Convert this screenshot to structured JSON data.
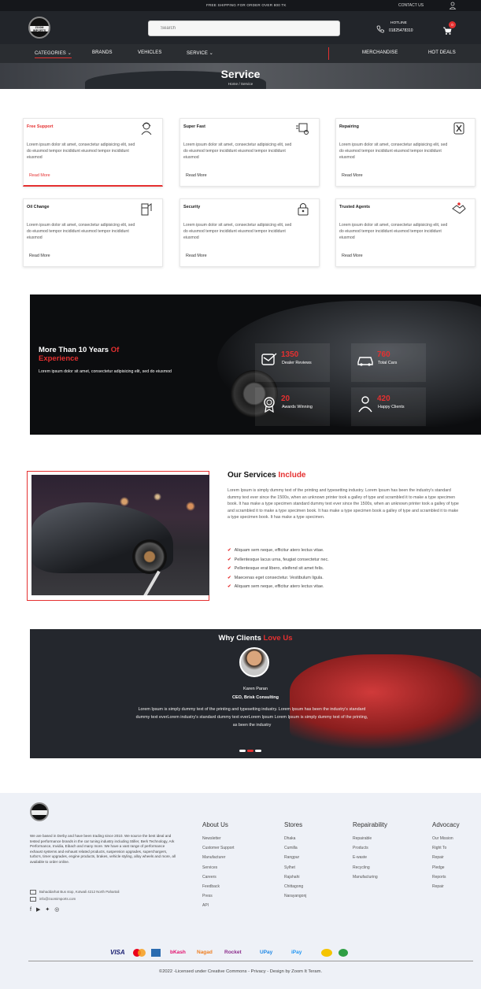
{
  "topbar": {
    "shipping": "FREE SHIPPING FOR ORDER OVER 800 TK",
    "contact": "CONTACT US"
  },
  "header": {
    "logo_text": "ZOOM IMPORTS",
    "search_placeholder": "Search",
    "hotline_label": "HOTLINE",
    "hotline_number": "01825478310",
    "cart_count": "0"
  },
  "nav": {
    "items": [
      "CATEGORIES",
      "BRANDS",
      "VEHICLES",
      "SERVICE",
      "MERCHANDISE",
      "HOT DEALS"
    ]
  },
  "hero": {
    "title": "Service",
    "breadcrumb": "Home / Service"
  },
  "services": [
    {
      "title": "Free Support",
      "desc": "Lorem ipsum dolor sit amet, consectetur adipisicing elit, sed do eiusmod tempor incididunt eiusmod tempor incididunt eiusmod",
      "link": "Read More",
      "icon": "support-agent-icon",
      "highlighted": true
    },
    {
      "title": "Super Fast",
      "desc": "Lorem ipsum dolor sit amet, consectetur adipisicing elit, sed do eiusmod tempor incididunt eiusmod tempor incididunt eiusmod",
      "link": "Read More",
      "icon": "fast-delivery-icon",
      "highlighted": false
    },
    {
      "title": "Repairing",
      "desc": "Lorem ipsum dolor sit amet, consectetur adipisicing elit, sed do eiusmod tempor incididunt eiusmod tempor incididunt eiusmod",
      "link": "Read More",
      "icon": "repair-tools-icon",
      "highlighted": false
    },
    {
      "title": "Oil Change",
      "desc": "Lorem ipsum dolor sit amet, consectetur adipisicing elit, sed do eiusmod tempor incididunt eiusmod tempor incididunt eiusmod",
      "link": "Read More",
      "icon": "fuel-pump-icon",
      "highlighted": false
    },
    {
      "title": "Security",
      "desc": "Lorem ipsum dolor sit amet, consectetur adipisicing elit, sed do eiusmod tempor incididunt eiusmod tempor incididunt eiusmod",
      "link": "Read More",
      "icon": "security-lock-icon",
      "highlighted": false
    },
    {
      "title": "Trusted Agents",
      "desc": "Lorem ipsum dolor sit amet, consectetur adipisicing elit, sed do eiusmod tempor incididunt eiusmod tempor incididunt eiusmod",
      "link": "Read More",
      "icon": "handshake-icon",
      "highlighted": false
    }
  ],
  "experience": {
    "title_main": "More Than 10 Years ",
    "title_red": "Of Experience",
    "subtitle": "Lorem ipsum dolor sit amet, consectetur adipisicing elit, sed do eiusmod",
    "stats": [
      {
        "value": "1350",
        "label": "Dealer Reviews",
        "icon": "review-icon"
      },
      {
        "value": "760",
        "label": "Total Cars",
        "icon": "car-icon"
      },
      {
        "value": "20",
        "label": "Awards Winning",
        "icon": "award-icon"
      },
      {
        "value": "420",
        "label": "Happy Clients",
        "icon": "clients-icon"
      }
    ]
  },
  "our_services": {
    "title_main": "Our Services ",
    "title_red": "Include",
    "desc": "Lorem Ipsum is simply dummy text of the printing and typesetting industry. Lorem Ipsum has been the industry's standard dummy text ever since the 1500s, when an unknown printer took a galley of type and scrambled it to make a type specimen book. It has make a type specimen standard dummy text ever since the 1500s, when an unknown printer took a galley of type and scrambled it to make a type specimen book. It has make a type specimen book a galley of type and scrambled it to make a type specimen book. It has make a type specimen.",
    "items": [
      "Aliquam sem neque, efficitur atero lectus vitae.",
      "Pellentesque lacus urna, feugiat consectetur nec.",
      "Pellentesque erat libero, eleifend sit amet felis.",
      "Maecenas eget consectetur. Vestibulum ligula.",
      "Aliquam sem neque, efficitur atero lectus vitae."
    ]
  },
  "testimonials": {
    "title_main": "Why Clients ",
    "title_red": "Love Us",
    "name": "Karen Paran",
    "role": "CEO, Brisk Consulting",
    "quote": "Lorem Ipsum is simply dummy text of the printing and typesetting industry. Lorem Ipsum has been the industry's standard dummy text everLorem industry's standard dummy text everLorem Ipsum Lorem Ipsum is simply dummy text of the printing, as been the industry"
  },
  "footer": {
    "about": "We are based in Derby and have been trading since 2010. We source the best ideal and tested performance brands in the car tuning industry including Stiller, Berk Technology, Ark Performance, Invidia, Eibach and many more. We have a vast range of performance exhaust systems and exhaust related products, suspension upgrades, superchargers, turbo's, timer upgrades, engine products, brakes, vehicle styling, alloy wheels and more, all available to order online.",
    "address": "Bahaddarhat Bus stop, Kotwali 4212 North Pahartali",
    "email": "info@zoomimports.com",
    "columns": [
      {
        "heading": "About Us",
        "items": [
          "Newsletter",
          "Customer Support",
          "Manufacturer",
          "Services",
          "Careers",
          "Feedback",
          "Press",
          "API"
        ]
      },
      {
        "heading": "Stores",
        "items": [
          "Dhaka",
          "Cumilla",
          "Rangpur",
          "Sylhet",
          "Rajshahi",
          "Chittagong",
          "Narayangonj"
        ]
      },
      {
        "heading": "Repairability",
        "items": [
          "Repairable",
          "Products",
          "E-waste",
          "Recycling",
          "Manufacturing"
        ]
      },
      {
        "heading": "Advocacy",
        "items": [
          "Our Mission",
          "Right To",
          "Repair",
          "Pledge",
          "Reports",
          "Repair"
        ]
      }
    ],
    "payments": [
      "VISA",
      "bKash",
      "Nagad",
      "Rocket",
      "UPay",
      "iPay"
    ],
    "copyright": "©2022 -Licensed under Creative Commons - Privacy - Design by Zoom It Teram."
  },
  "colors": {
    "accent": "#e53030",
    "dark": "#22252a",
    "footer_bg": "#eef1f7"
  }
}
